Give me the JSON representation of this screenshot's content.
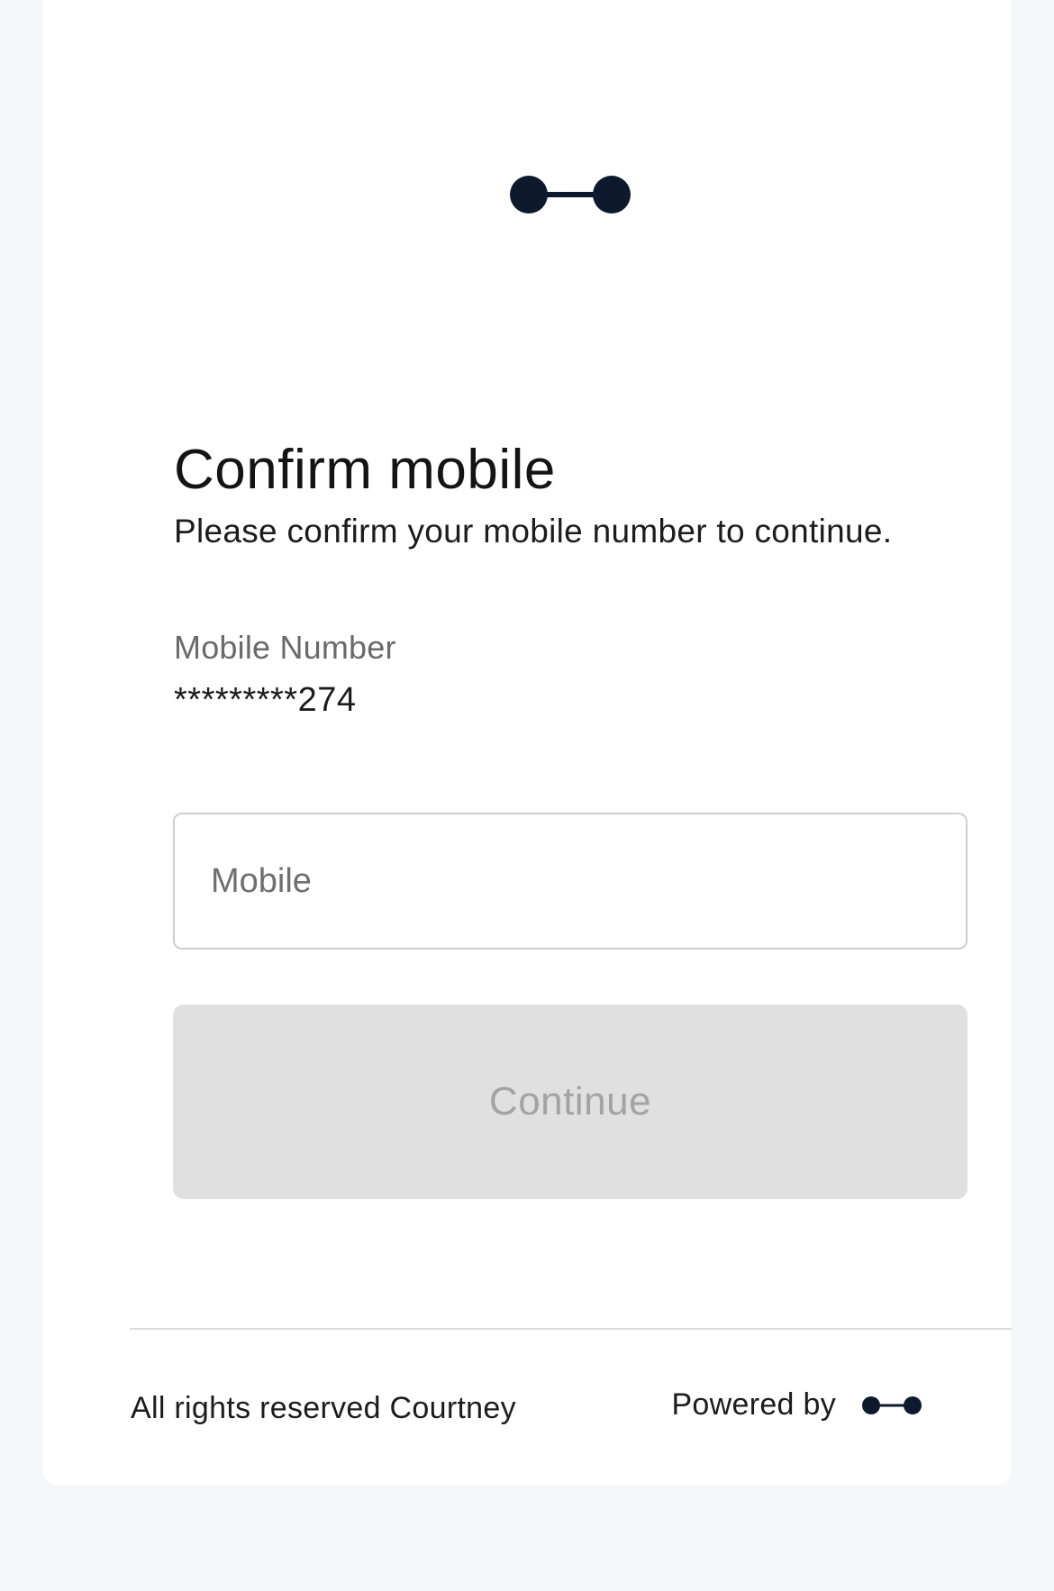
{
  "brand": {
    "logo_icon": "connector-dots-logo",
    "logo_color": "#0d1a2e"
  },
  "page": {
    "title": "Confirm mobile",
    "subtitle": "Please confirm your mobile number to continue."
  },
  "mobile_info": {
    "label": "Mobile Number",
    "masked_value": "*********274"
  },
  "mobile_input": {
    "placeholder": "Mobile",
    "value": ""
  },
  "continue_button": {
    "label": "Continue",
    "state": "disabled"
  },
  "footer": {
    "rights_text": "All rights reserved Courtney",
    "powered_by_label": "Powered by",
    "powered_by_icon": "connector-dots-logo"
  },
  "colors": {
    "page_background": "#f6f7f9",
    "card_background": "#ffffff",
    "button_disabled_background": "#e0e0e0",
    "button_disabled_text": "#a3a3a3"
  }
}
